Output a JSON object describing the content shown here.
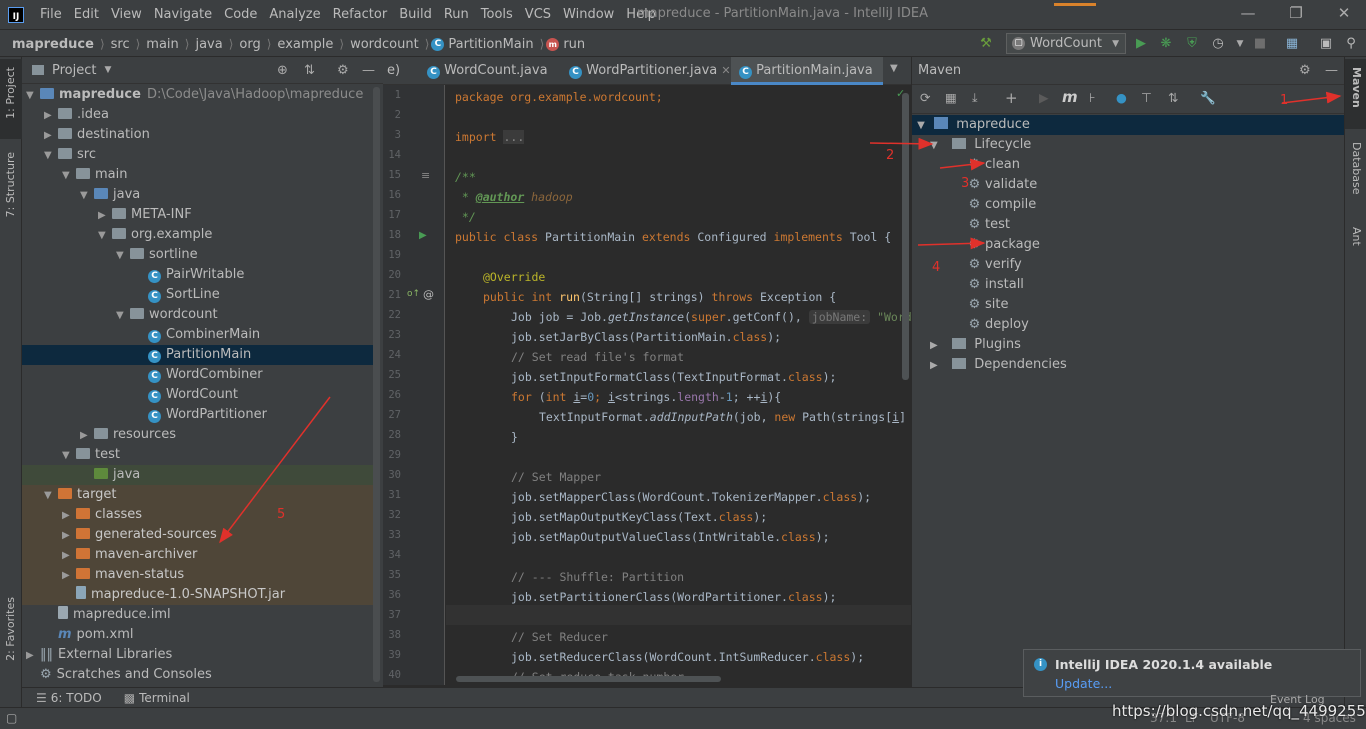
{
  "menu": {
    "items": [
      "File",
      "Edit",
      "View",
      "Navigate",
      "Code",
      "Analyze",
      "Refactor",
      "Build",
      "Run",
      "Tools",
      "VCS",
      "Window",
      "Help"
    ],
    "window_title": "mapreduce - PartitionMain.java - IntelliJ IDEA"
  },
  "nav": {
    "crumbs": [
      "mapreduce",
      "src",
      "main",
      "java",
      "org",
      "example",
      "wordcount",
      "PartitionMain",
      "run"
    ],
    "run_config": "WordCount"
  },
  "project_panel": {
    "title": "Project",
    "tree": [
      {
        "label": "mapreduce",
        "extra": "D:\\Code\\Java\\Hadoop\\mapreduce",
        "depth": 0,
        "arrow": "open",
        "kind": "module"
      },
      {
        "label": ".idea",
        "depth": 1,
        "arrow": "closed",
        "kind": "folder"
      },
      {
        "label": "destination",
        "depth": 1,
        "arrow": "closed",
        "kind": "folder"
      },
      {
        "label": "src",
        "depth": 1,
        "arrow": "open",
        "kind": "folder"
      },
      {
        "label": "main",
        "depth": 2,
        "arrow": "open",
        "kind": "folder"
      },
      {
        "label": "java",
        "depth": 3,
        "arrow": "open",
        "kind": "blue"
      },
      {
        "label": "META-INF",
        "depth": 4,
        "arrow": "closed",
        "kind": "folder"
      },
      {
        "label": "org.example",
        "depth": 4,
        "arrow": "open",
        "kind": "folder"
      },
      {
        "label": "sortline",
        "depth": 5,
        "arrow": "open",
        "kind": "folder"
      },
      {
        "label": "PairWritable",
        "depth": 6,
        "arrow": "none",
        "kind": "class"
      },
      {
        "label": "SortLine",
        "depth": 6,
        "arrow": "none",
        "kind": "class"
      },
      {
        "label": "wordcount",
        "depth": 5,
        "arrow": "open",
        "kind": "folder"
      },
      {
        "label": "CombinerMain",
        "depth": 6,
        "arrow": "none",
        "kind": "class"
      },
      {
        "label": "PartitionMain",
        "depth": 6,
        "arrow": "none",
        "kind": "class",
        "selected": true
      },
      {
        "label": "WordCombiner",
        "depth": 6,
        "arrow": "none",
        "kind": "class"
      },
      {
        "label": "WordCount",
        "depth": 6,
        "arrow": "none",
        "kind": "class"
      },
      {
        "label": "WordPartitioner",
        "depth": 6,
        "arrow": "none",
        "kind": "class"
      },
      {
        "label": "resources",
        "depth": 3,
        "arrow": "closed",
        "kind": "folder"
      },
      {
        "label": "test",
        "depth": 2,
        "arrow": "open",
        "kind": "folder"
      },
      {
        "label": "java",
        "depth": 3,
        "arrow": "none",
        "kind": "green"
      },
      {
        "label": "target",
        "depth": 1,
        "arrow": "open",
        "kind": "orange"
      },
      {
        "label": "classes",
        "depth": 2,
        "arrow": "closed",
        "kind": "orange"
      },
      {
        "label": "generated-sources",
        "depth": 2,
        "arrow": "closed",
        "kind": "orange"
      },
      {
        "label": "maven-archiver",
        "depth": 2,
        "arrow": "closed",
        "kind": "orange"
      },
      {
        "label": "maven-status",
        "depth": 2,
        "arrow": "closed",
        "kind": "orange"
      },
      {
        "label": "mapreduce-1.0-SNAPSHOT.jar",
        "depth": 2,
        "arrow": "none",
        "kind": "jar"
      },
      {
        "label": "mapreduce.iml",
        "depth": 1,
        "arrow": "none",
        "kind": "file"
      },
      {
        "label": "pom.xml",
        "depth": 1,
        "arrow": "none",
        "kind": "maven"
      },
      {
        "label": "External Libraries",
        "depth": 0,
        "arrow": "closed",
        "kind": "lib"
      },
      {
        "label": "Scratches and Consoles",
        "depth": 0,
        "arrow": "none",
        "kind": "scratch"
      }
    ]
  },
  "editor": {
    "tabs": [
      {
        "label": "e)",
        "active": false
      },
      {
        "label": "WordCount.java",
        "active": false
      },
      {
        "label": "WordPartitioner.java",
        "active": false
      },
      {
        "label": "PartitionMain.java",
        "active": true
      }
    ],
    "line_numbers": [
      "1",
      "2",
      "3",
      "14",
      "15",
      "16",
      "17",
      "18",
      "19",
      "20",
      "21",
      "22",
      "23",
      "24",
      "25",
      "26",
      "27",
      "28",
      "29",
      "30",
      "31",
      "32",
      "33",
      "34",
      "35",
      "36",
      "37",
      "38",
      "39",
      "40"
    ],
    "code": {
      "l1": "package org.example.wordcount;",
      "l3a": "import",
      "l3b": "...",
      "l15": "/**",
      "l16a": " * ",
      "l16b": "@author",
      "l16c": " hadoop",
      "l17": " */",
      "l18a": "public class ",
      "l18b": "PartitionMain ",
      "l18c": "extends ",
      "l18d": "Configured ",
      "l18e": "implements ",
      "l18f": "Tool {",
      "l20": "@Override",
      "l21a": "public int ",
      "l21b": "run",
      "l21c": "(String[] strings) ",
      "l21d": "throws ",
      "l21e": "Exception {",
      "l22a": "Job job = Job.",
      "l22b": "getInstance",
      "l22c": "(",
      "l22d": "super",
      "l22e": ".getConf(), ",
      "l22f": "jobName:",
      "l22g": " \"Word",
      "l23a": "job.setJarByClass(PartitionMain.",
      "l23b": "class",
      "l23c": ");",
      "l24": "// Set read file's format",
      "l25a": "job.setInputFormatClass(TextInputFormat.",
      "l25b": "class",
      "l25c": ");",
      "l26a": "for ",
      "l26b": "(",
      "l26c": "int ",
      "l26d": "i",
      "l26e": "=",
      "l26f": "0",
      "l26g": "; ",
      "l26h": "i",
      "l26i": "<strings.",
      "l26j": "length",
      "l26k": "-",
      "l26l": "1",
      "l26m": "; ++",
      "l26n": "i",
      "l26o": "){",
      "l27a": "TextInputFormat.",
      "l27b": "addInputPath",
      "l27c": "(job, ",
      "l27d": "new ",
      "l27e": "Path(strings[",
      "l27f": "i",
      "l27g": "]",
      "l28": "}",
      "l30": "// Set Mapper",
      "l31a": "job.setMapperClass(WordCount.TokenizerMapper.",
      "l31b": "class",
      "l31c": ");",
      "l32a": "job.setMapOutputKeyClass(Text.",
      "l32b": "class",
      "l32c": ");",
      "l33a": "job.setMapOutputValueClass(IntWritable.",
      "l33b": "class",
      "l33c": ");",
      "l35": "// --- Shuffle: Partition",
      "l36a": "job.setPartitionerClass(WordPartitioner.",
      "l36b": "class",
      "l36c": ");",
      "l38": "// Set Reducer",
      "l39a": "job.setReducerClass(WordCount.IntSumReducer.",
      "l39b": "class",
      "l39c": ");",
      "l40": "// Set reduce task number"
    }
  },
  "maven": {
    "title": "Maven",
    "root": "mapreduce",
    "lifecycle_label": "Lifecycle",
    "goals": [
      "clean",
      "validate",
      "compile",
      "test",
      "package",
      "verify",
      "install",
      "site",
      "deploy"
    ],
    "plugins_label": "Plugins",
    "dependencies_label": "Dependencies"
  },
  "side_tabs": {
    "left": [
      "1: Project",
      "7: Structure",
      "2: Favorites"
    ],
    "right": [
      "Maven",
      "Database",
      "Ant"
    ]
  },
  "bottom_tabs": [
    "6: TODO",
    "Terminal"
  ],
  "notification": {
    "title": "IntelliJ IDEA 2020.1.4 available",
    "link": "Update..."
  },
  "status": {
    "position": "37:1",
    "line_sep": "LF",
    "encoding": "UTF-8",
    "indent": "4 spaces",
    "event_log": "Event Log",
    "watermark": "https://blog.csdn.net/qq_44992559"
  },
  "annotations": [
    "1",
    "2",
    "3",
    "4",
    "5"
  ],
  "colors": {
    "accent": "#4a88c7",
    "arrow": "#e0312b",
    "selection": "#0d293e",
    "target_bg": "#5c4f3a"
  }
}
